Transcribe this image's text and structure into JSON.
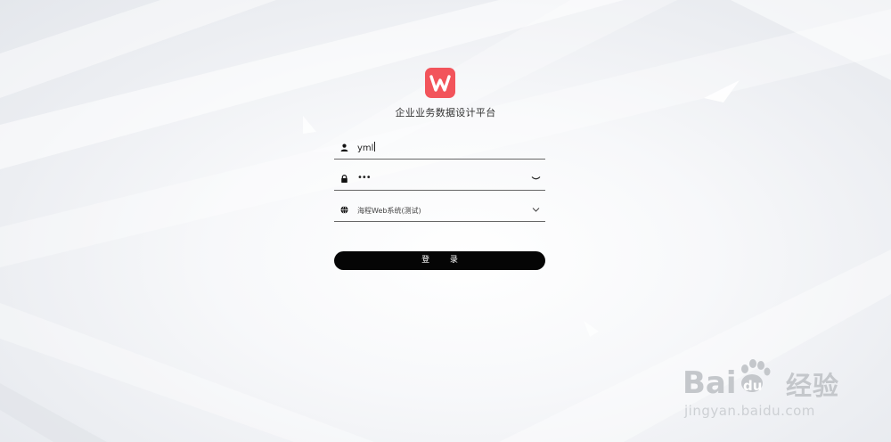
{
  "app": {
    "logo_icon": "w-logo-icon",
    "logo_color": "#f2545b",
    "title": "企业业务数据设计平台"
  },
  "login": {
    "username": {
      "icon": "user-icon",
      "value": "yml"
    },
    "password": {
      "icon": "lock-icon",
      "value": "•••",
      "toggle_icon": "eye-closed-icon"
    },
    "system_select": {
      "icon": "globe-icon",
      "selected": "海程Web系统(测试)",
      "chevron_icon": "chevron-down-icon"
    },
    "submit_label": "登 录"
  },
  "watermark": {
    "brand": "Bai",
    "brand_tail": "du",
    "brand_cn": "经验",
    "url": "jingyan.baidu.com"
  }
}
